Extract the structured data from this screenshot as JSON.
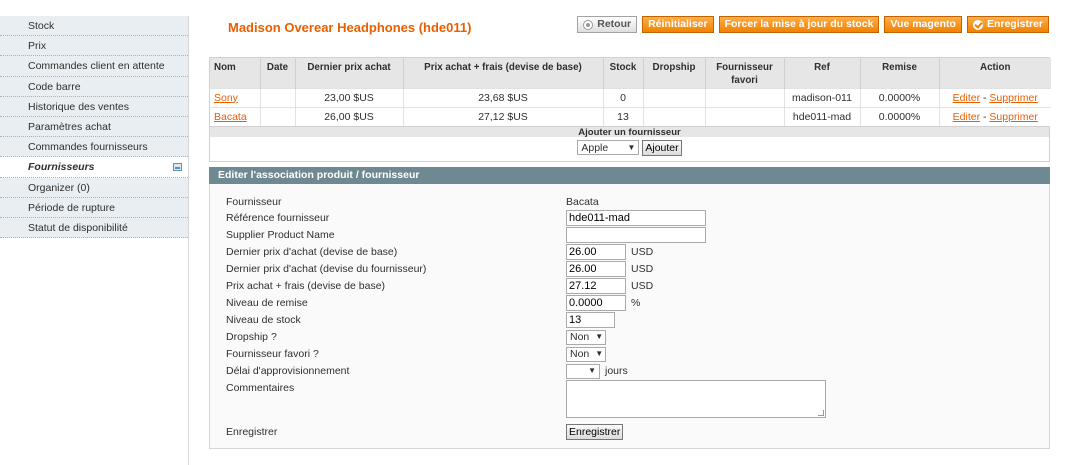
{
  "sidebar": {
    "items": [
      {
        "label": "Stock"
      },
      {
        "label": "Prix"
      },
      {
        "label": "Commandes client en attente"
      },
      {
        "label": "Code barre"
      },
      {
        "label": "Historique des ventes"
      },
      {
        "label": "Paramètres achat"
      },
      {
        "label": "Commandes fournisseurs"
      },
      {
        "label": "Fournisseurs",
        "active": true
      },
      {
        "label": "Organizer (0)"
      },
      {
        "label": "Période de rupture"
      },
      {
        "label": "Statut de disponibilité"
      }
    ]
  },
  "header": {
    "title": "Madison Overear Headphones (hde011)",
    "buttons": {
      "back": "Retour",
      "reset": "Réinitialiser",
      "force_stock": "Forcer la mise à jour du stock",
      "magento_view": "Vue magento",
      "save": "Enregistrer"
    }
  },
  "suppliers_table": {
    "columns": [
      "Nom",
      "Date",
      "Dernier prix achat",
      "Prix achat + frais (devise de base)",
      "Stock",
      "Dropship",
      "Fournisseur favori",
      "Ref",
      "Remise",
      "Action"
    ],
    "rows": [
      {
        "name": "Sony",
        "date": "",
        "last_price": "23,00 $US",
        "price_fees": "23,68 $US",
        "stock": "0",
        "dropship": "",
        "favorite": "",
        "ref": "madison-011",
        "discount": "0.0000%",
        "edit": "Editer",
        "sep": "-",
        "delete": "Supprimer"
      },
      {
        "name": "Bacata",
        "date": "",
        "last_price": "26,00 $US",
        "price_fees": "27,12 $US",
        "stock": "13",
        "dropship": "",
        "favorite": "",
        "ref": "hde011-mad",
        "discount": "0.0000%",
        "edit": "Editer",
        "sep": "-",
        "delete": "Supprimer"
      }
    ],
    "add_label": "Ajouter un fournisseur",
    "add_select_value": "Apple",
    "add_button": "Ajouter"
  },
  "edit_form": {
    "header": "Editer l'association produit / fournisseur",
    "supplier_label": "Fournisseur",
    "supplier_value": "Bacata",
    "ref_label": "Référence fournisseur",
    "ref_value": "hde011-mad",
    "product_name_label": "Supplier Product Name",
    "product_name_value": "",
    "last_price_base_label": "Dernier prix d'achat (devise de base)",
    "last_price_base_value": "26.00",
    "last_price_base_unit": "USD",
    "last_price_supplier_label": "Dernier prix d'achat (devise du fournisseur)",
    "last_price_supplier_value": "26.00",
    "last_price_supplier_unit": "USD",
    "price_fees_label": "Prix achat + frais (devise de base)",
    "price_fees_value": "27.12",
    "price_fees_unit": "USD",
    "discount_label": "Niveau de remise",
    "discount_value": "0.0000",
    "discount_unit": "%",
    "stock_label": "Niveau de stock",
    "stock_value": "13",
    "dropship_label": "Dropship ?",
    "dropship_value": "Non",
    "favorite_label": "Fournisseur favori ?",
    "favorite_value": "Non",
    "lead_time_label": "Délai d'approvisionnement",
    "lead_time_value": "",
    "lead_time_unit": "jours",
    "comments_label": "Commentaires",
    "save_label": "Enregistrer",
    "save_button": "Enregistrer"
  },
  "colors": {
    "accent": "#eb5e00",
    "button_orange": "#f18200",
    "section_header": "#6f8992",
    "sidebar_bg": "#e8eef1"
  }
}
